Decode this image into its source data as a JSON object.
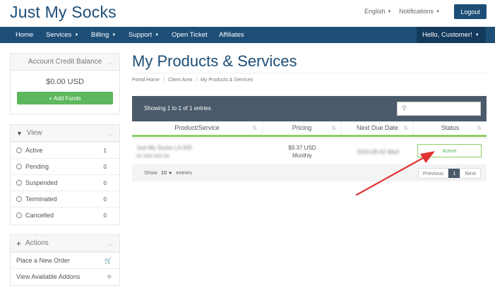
{
  "brand": "Just My Socks",
  "top_links": {
    "language": "English",
    "notifications": "Notifications",
    "logout": "Logout"
  },
  "nav": {
    "items": [
      {
        "label": "Home"
      },
      {
        "label": "Services"
      },
      {
        "label": "Billing"
      },
      {
        "label": "Support"
      },
      {
        "label": "Open Ticket"
      },
      {
        "label": "Affiliates"
      }
    ],
    "user": "Hello, Customer!"
  },
  "credit": {
    "title": "Account Credit Balance",
    "amount": "$0.00 USD",
    "add_funds": "Add Funds"
  },
  "view": {
    "title": "View",
    "items": [
      {
        "label": "Active",
        "count": "1"
      },
      {
        "label": "Pending",
        "count": "0"
      },
      {
        "label": "Suspended",
        "count": "0"
      },
      {
        "label": "Terminated",
        "count": "0"
      },
      {
        "label": "Cancelled",
        "count": "0"
      }
    ]
  },
  "actions": {
    "title": "Actions",
    "items": [
      {
        "label": "Place a New Order",
        "icon": "cart-icon"
      },
      {
        "label": "View Available Addons",
        "icon": "cubes-icon"
      }
    ]
  },
  "page": {
    "title": "My Products & Services",
    "breadcrumb": [
      "Portal Home",
      "Client Area",
      "My Products & Services"
    ]
  },
  "table": {
    "info": "Showing 1 to 1 of 1 entries",
    "columns": [
      "Product/Service",
      "Pricing",
      "Next Due Date",
      "Status"
    ],
    "rows": [
      {
        "product_line1": "Just My Socks LA 500",
        "product_line2": "xx.xxx.xxx.xx",
        "price": "$9.37 USD",
        "cycle": "Monthly",
        "due": "2020-09-02 Wed",
        "status": "Active"
      }
    ],
    "show_label": "Show",
    "show_value": "10",
    "entries_label": "entries",
    "pager": {
      "prev": "Previous",
      "current": "1",
      "next": "Next"
    }
  },
  "colors": {
    "brand": "#1d4e77",
    "nav": "#1d4e77",
    "success": "#5cb85c",
    "table_header": "#4a5a6b",
    "annotation": "#e03232"
  }
}
